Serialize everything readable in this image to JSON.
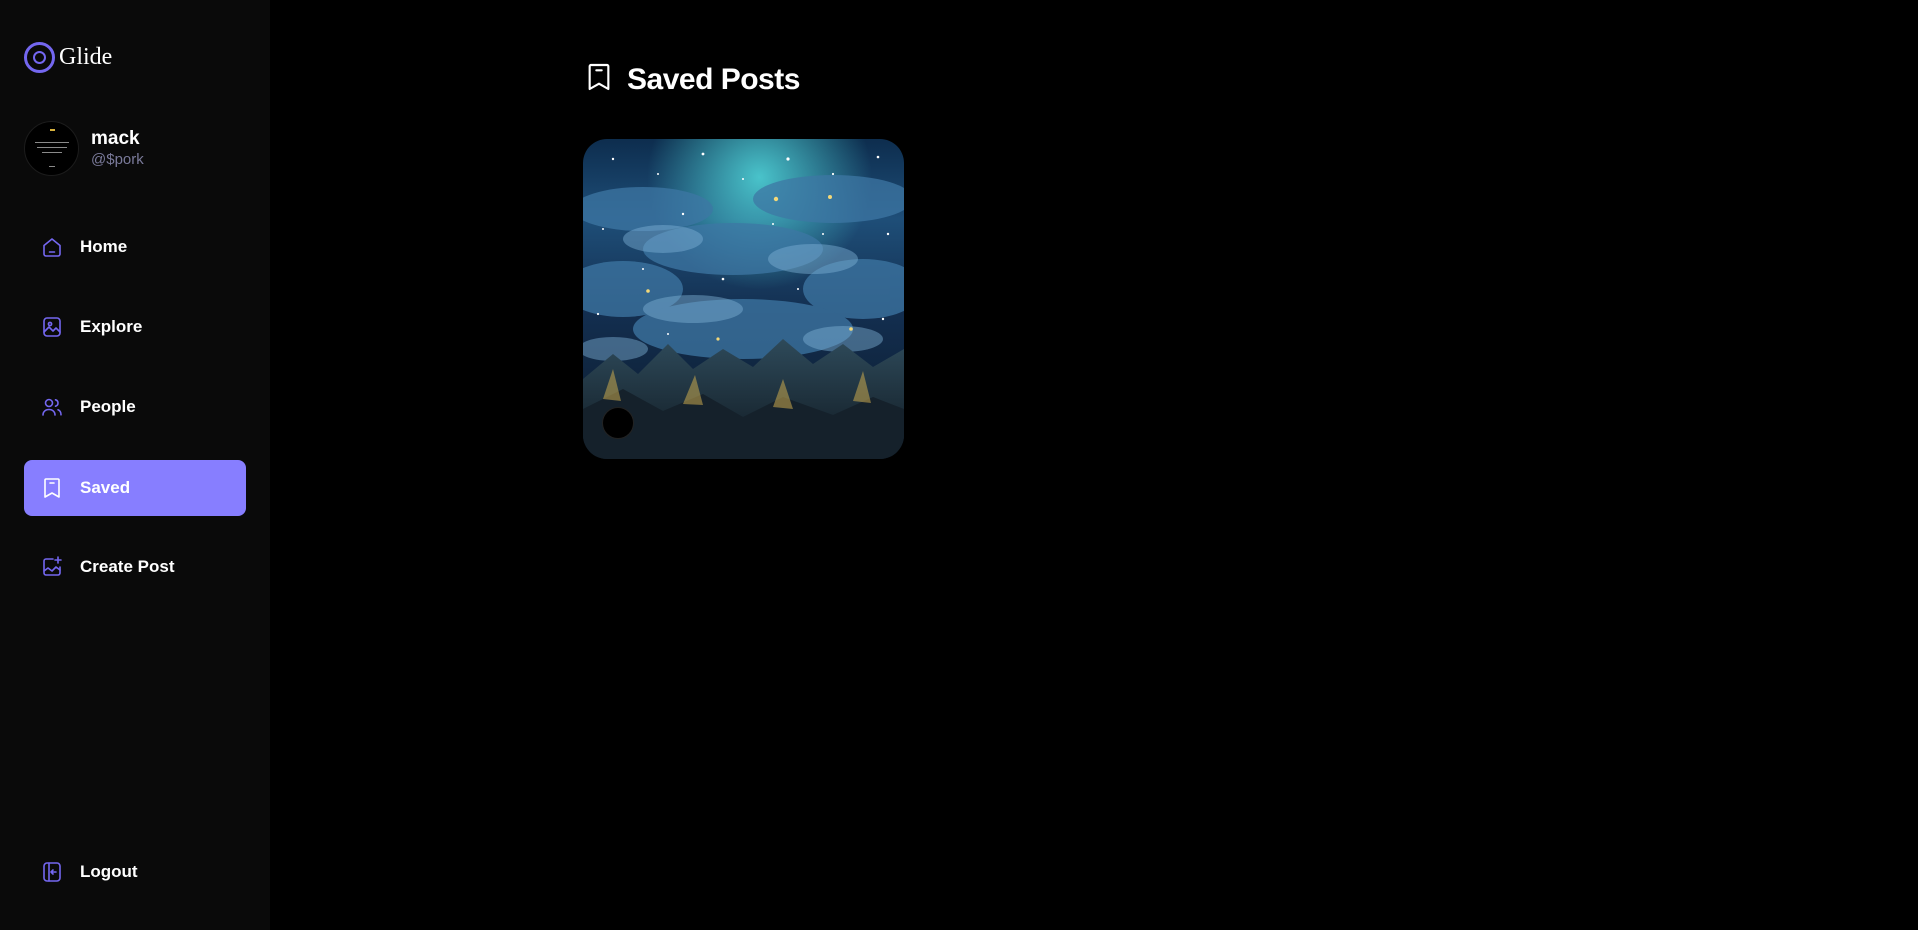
{
  "app": {
    "name": "Glide"
  },
  "user": {
    "name": "mack",
    "handle": "@$pork"
  },
  "nav": [
    {
      "label": "Home",
      "icon": "home-icon",
      "active": false
    },
    {
      "label": "Explore",
      "icon": "explore-icon",
      "active": false
    },
    {
      "label": "People",
      "icon": "people-icon",
      "active": false
    },
    {
      "label": "Saved",
      "icon": "bookmark-icon",
      "active": true
    },
    {
      "label": "Create Post",
      "icon": "create-post-icon",
      "active": false
    }
  ],
  "logout": {
    "label": "Logout",
    "icon": "logout-icon"
  },
  "page": {
    "title": "Saved Posts",
    "icon": "bookmark-icon"
  },
  "colors": {
    "accent": "#877eff",
    "sidebar_bg": "#0a0a0a",
    "page_bg": "#000000",
    "icon_stroke": "#7467f0"
  },
  "saved_posts": [
    {
      "image": "starry-night-clouds-mountains"
    }
  ]
}
